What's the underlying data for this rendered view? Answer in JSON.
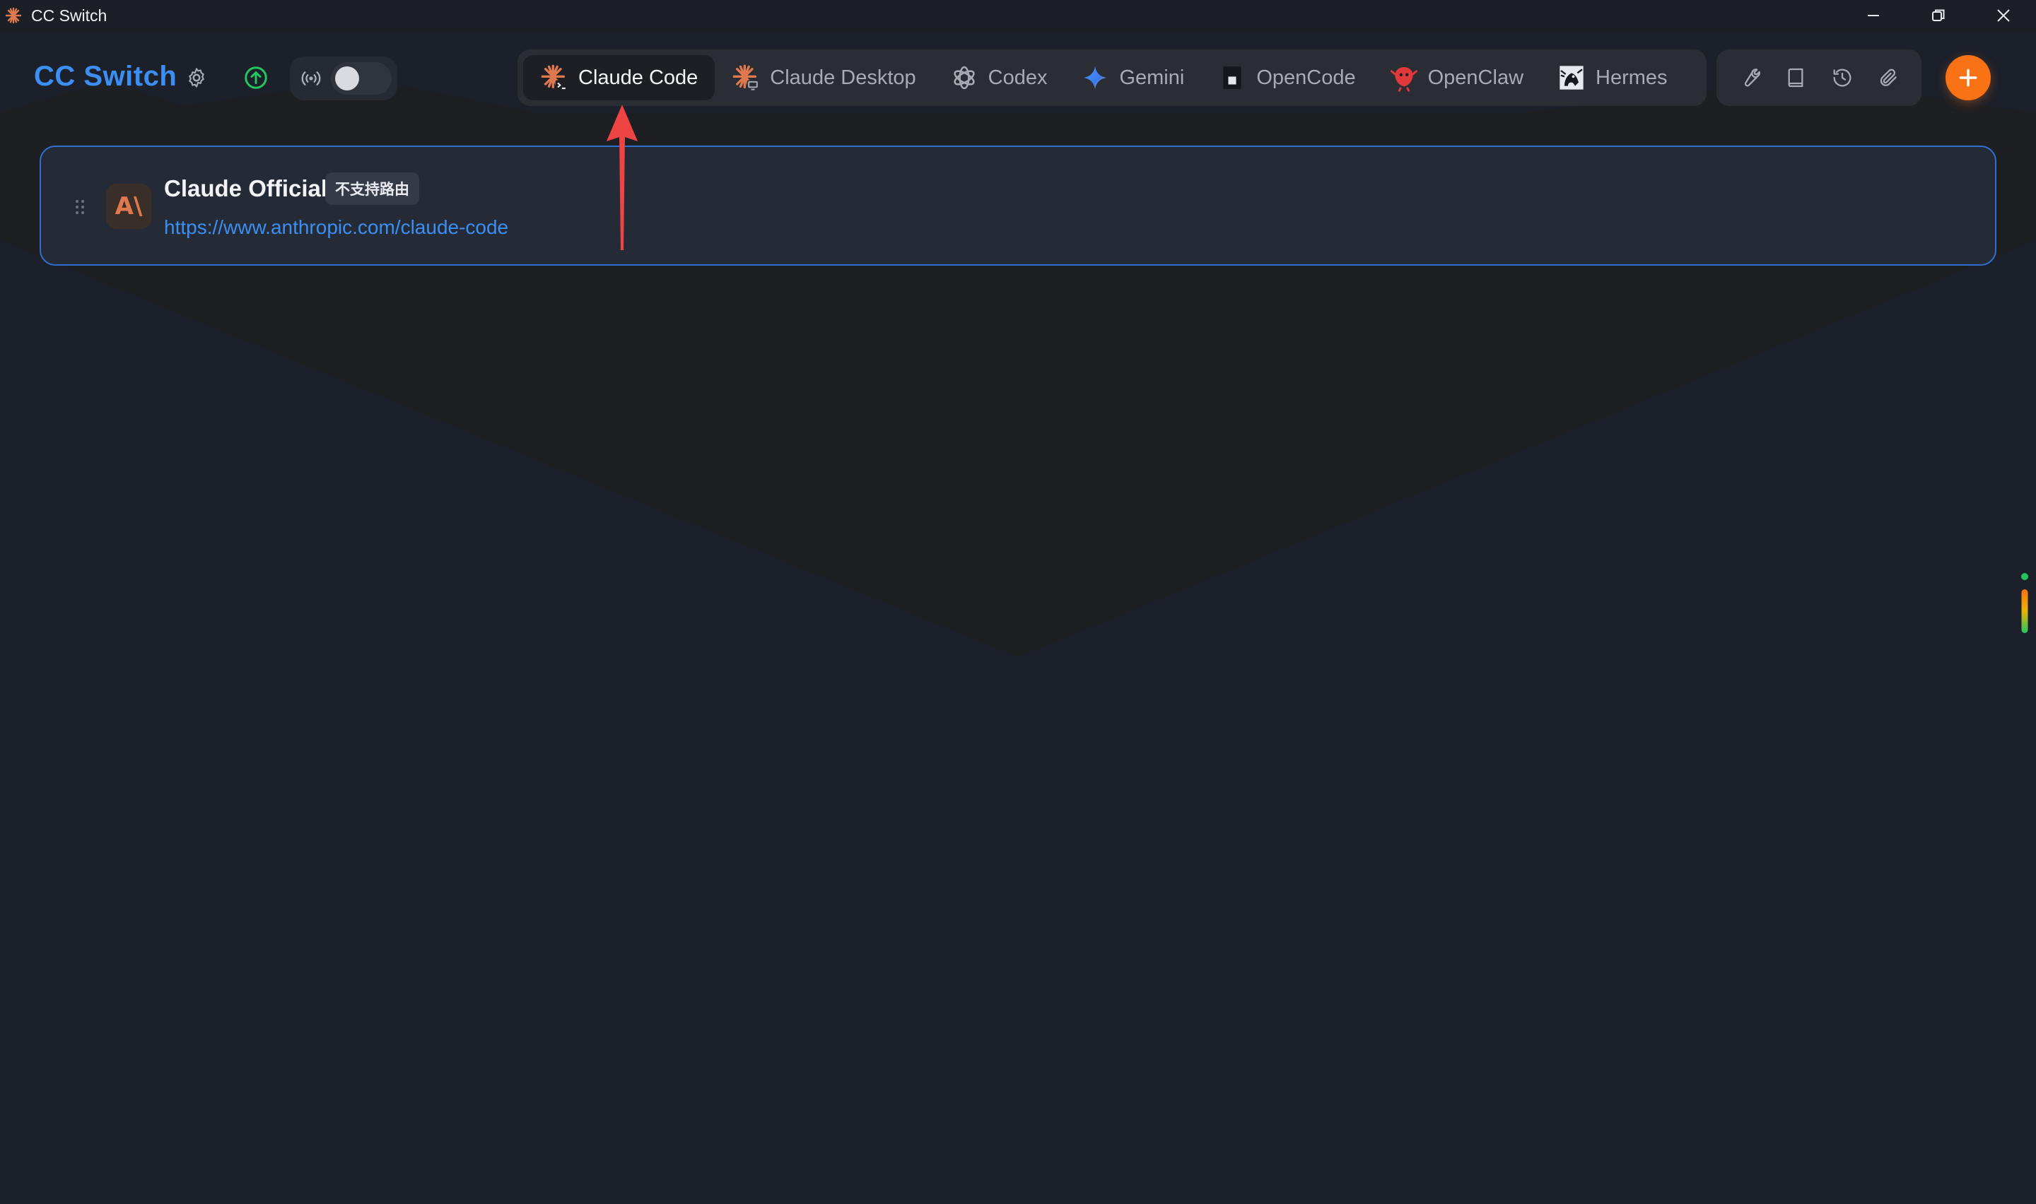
{
  "window": {
    "title": "CC Switch"
  },
  "header": {
    "brand": "CC Switch"
  },
  "tabs": [
    {
      "label": "Claude Code",
      "icon": "claude-code-icon",
      "active": true
    },
    {
      "label": "Claude Desktop",
      "icon": "claude-desktop-icon",
      "active": false
    },
    {
      "label": "Codex",
      "icon": "openai-icon",
      "active": false
    },
    {
      "label": "Gemini",
      "icon": "gemini-icon",
      "active": false
    },
    {
      "label": "OpenCode",
      "icon": "opencode-icon",
      "active": false
    },
    {
      "label": "OpenClaw",
      "icon": "openclaw-icon",
      "active": false
    },
    {
      "label": "Hermes",
      "icon": "hermes-icon",
      "active": false
    }
  ],
  "toolbar": {
    "tools": [
      "wrench-icon",
      "book-icon",
      "history-icon",
      "paperclip-icon"
    ],
    "add_icon": "plus-icon"
  },
  "providers": [
    {
      "name": "Claude Official",
      "badge": "不支持路由",
      "url": "https://www.anthropic.com/claude-code",
      "logo_text": "A\\"
    }
  ],
  "colors": {
    "brand": "#3b8ff3",
    "accent": "#f97316",
    "card_border": "#2f6fd0",
    "annotation": "#ef4444"
  }
}
